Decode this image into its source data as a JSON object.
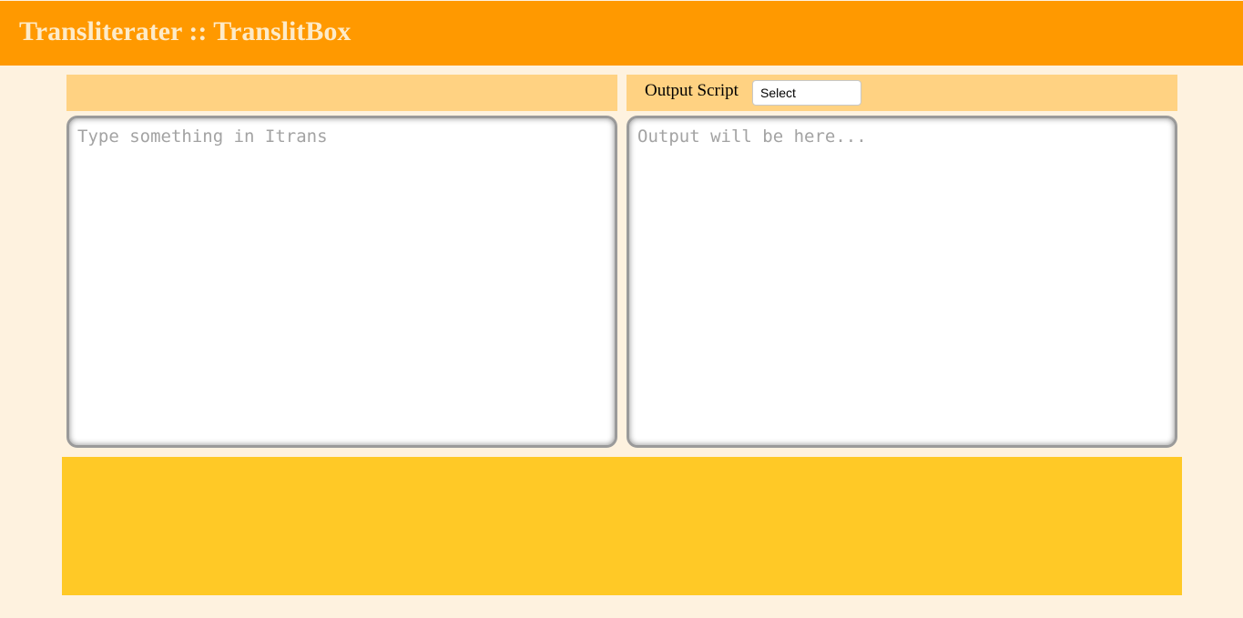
{
  "header": {
    "title": "Transliterater :: TranslitBox"
  },
  "toolbar": {
    "output_script_label": "Output Script",
    "output_script_selected": "Select"
  },
  "input": {
    "placeholder": "Type something in Itrans",
    "value": ""
  },
  "output": {
    "placeholder": "Output will be here...",
    "value": ""
  },
  "colors": {
    "header_bg": "#ff9900",
    "title_text": "#fdebc9",
    "page_bg": "#fef2df",
    "toolbar_bg": "#ffd282",
    "footer_bg": "#ffc926"
  }
}
